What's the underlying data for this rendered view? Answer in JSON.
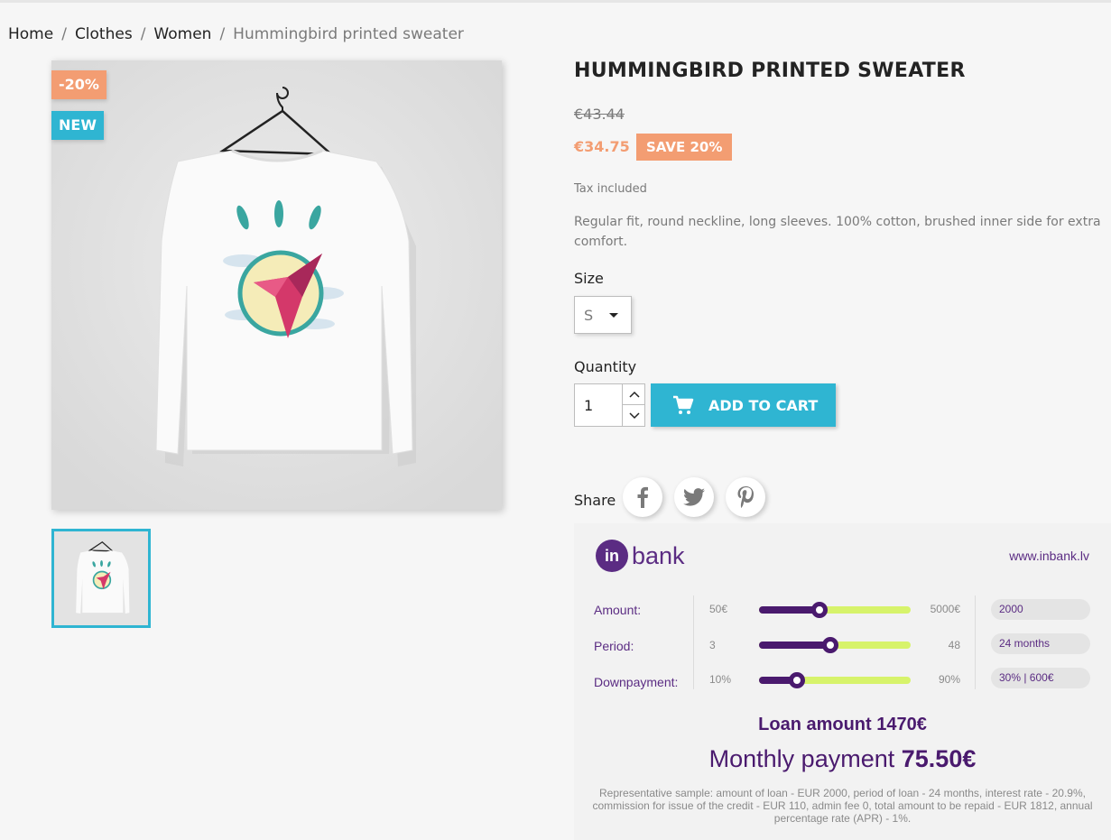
{
  "breadcrumb": {
    "items": [
      "Home",
      "Clothes",
      "Women",
      "Hummingbird printed sweater"
    ],
    "separator": "/"
  },
  "product": {
    "title": "HUMMINGBIRD PRINTED SWEATER",
    "flags": {
      "discount": "-20%",
      "new": "NEW"
    },
    "regular_price": "€43.44",
    "price": "€34.75",
    "save_label": "SAVE 20%",
    "tax_label": "Tax included",
    "description": "Regular fit, round neckline, long sleeves. 100% cotton, brushed inner side for extra comfort.",
    "size_label": "Size",
    "size_value": "S",
    "quantity_label": "Quantity",
    "quantity_value": "1",
    "add_to_cart_label": "ADD TO CART",
    "share_label": "Share"
  },
  "inbank": {
    "logo_mark": "in",
    "logo_word": "bank",
    "url": "www.inbank.lv",
    "rows": [
      {
        "label": "Amount:",
        "min": "50€",
        "max": "5000€",
        "value": "2000",
        "level": 0.4
      },
      {
        "label": "Period:",
        "min": "3",
        "max": "48",
        "value": "24 months",
        "level": 0.47
      },
      {
        "label": "Downpayment:",
        "min": "10%",
        "max": "90%",
        "value": "30% | 600€",
        "level": 0.25
      }
    ],
    "loan_amount": "Loan amount 1470€",
    "monthly_prefix": "Monthly payment",
    "monthly_value": "75.50€",
    "disclaimer": "Representative sample: amount of loan - EUR 2000, period of loan - 24 months, interest rate - 20.9%, commission for issue of the credit - EUR 110, admin fee 0, total amount to be repaid - EUR 1812, annual percentage rate (APR) - 1%."
  },
  "colors": {
    "accent": "#2fb5d2",
    "discount": "#f39d72",
    "inbank_purple": "#5b2c83",
    "slider_track": "#d7f36b"
  },
  "icons": [
    "shopping-cart-icon",
    "facebook-icon",
    "twitter-icon",
    "pinterest-icon",
    "chevron-up-icon",
    "chevron-down-icon"
  ]
}
